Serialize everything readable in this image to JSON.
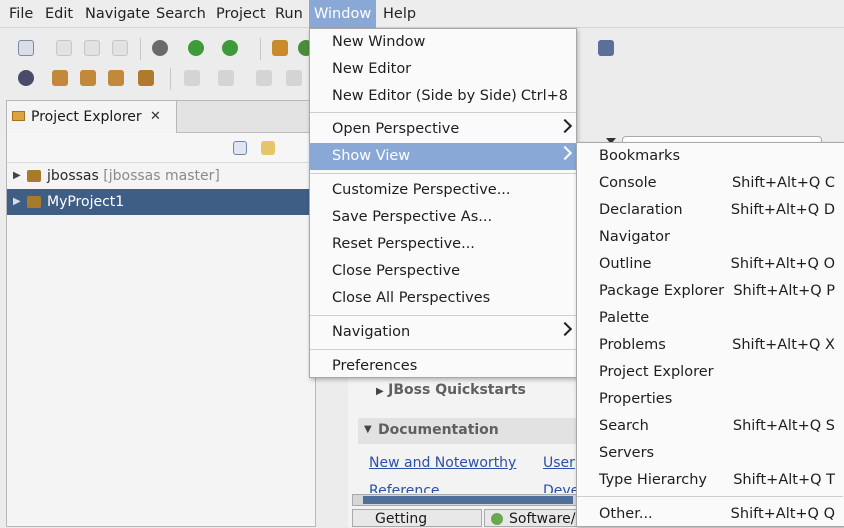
{
  "menubar": {
    "items": [
      "File",
      "Edit",
      "Navigate",
      "Search",
      "Project",
      "Run",
      "Window",
      "Help"
    ],
    "active": "Window"
  },
  "project_explorer": {
    "tab_label": "Project Explorer",
    "close_glyph": "✕",
    "rows": [
      {
        "name": "jbossas",
        "decoration": "[jbossas master]",
        "selected": false
      },
      {
        "name": "MyProject1",
        "decoration": "",
        "selected": true
      }
    ]
  },
  "background_panel": {
    "quickstarts": "JBoss Quickstarts",
    "documentation": "Documentation",
    "link_new": "New and Noteworthy",
    "link_user": "User",
    "link_reference": "Reference",
    "link_dev": "Deve",
    "bottom_tab_1": "Getting Started",
    "bottom_tab_2": "Software/"
  },
  "window_menu": {
    "items": [
      {
        "label": "New Window"
      },
      {
        "label": "New Editor"
      },
      {
        "label": "New Editor (Side by Side)",
        "accel": "Ctrl+8"
      },
      {
        "label": "Open Perspective",
        "submenu": true
      },
      {
        "label": "Show View",
        "submenu": true,
        "highlighted": true
      },
      {
        "label": "Customize Perspective..."
      },
      {
        "label": "Save Perspective As..."
      },
      {
        "label": "Reset Perspective..."
      },
      {
        "label": "Close Perspective"
      },
      {
        "label": "Close All Perspectives"
      },
      {
        "label": "Navigation",
        "submenu": true
      },
      {
        "label": "Preferences"
      }
    ]
  },
  "show_view_menu": {
    "items": [
      {
        "label": "Bookmarks",
        "accel": ""
      },
      {
        "label": "Console",
        "accel": "Shift+Alt+Q C"
      },
      {
        "label": "Declaration",
        "accel": "Shift+Alt+Q D"
      },
      {
        "label": "Navigator",
        "accel": ""
      },
      {
        "label": "Outline",
        "accel": "Shift+Alt+Q O"
      },
      {
        "label": "Package Explorer",
        "accel": "Shift+Alt+Q P"
      },
      {
        "label": "Palette",
        "accel": ""
      },
      {
        "label": "Problems",
        "accel": "Shift+Alt+Q X"
      },
      {
        "label": "Project Explorer",
        "accel": ""
      },
      {
        "label": "Properties",
        "accel": ""
      },
      {
        "label": "Search",
        "accel": "Shift+Alt+Q S"
      },
      {
        "label": "Servers",
        "accel": ""
      },
      {
        "label": "Type Hierarchy",
        "accel": "Shift+Alt+Q T"
      },
      {
        "label": "Other...",
        "accel": "Shift+Alt+Q Q"
      }
    ]
  },
  "colors": {
    "highlight": "#89a8d6",
    "selection": "#3f5e86",
    "link": "#2c4fa8"
  }
}
